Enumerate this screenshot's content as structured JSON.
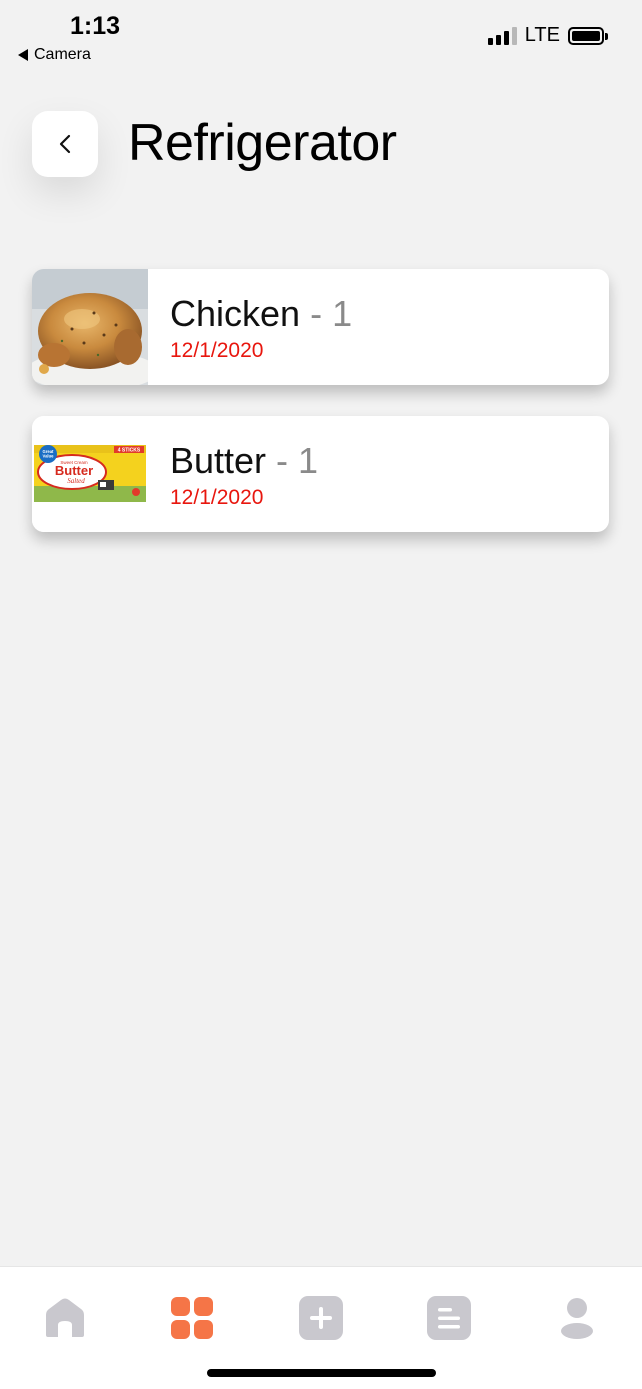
{
  "status_bar": {
    "time": "1:13",
    "back_app": "Camera",
    "network": "LTE"
  },
  "header": {
    "title": "Refrigerator",
    "back_icon": "chevron-left-icon"
  },
  "items": [
    {
      "name": "Chicken",
      "separator": " - ",
      "quantity": "1",
      "date": "12/1/2020",
      "image": "roast-chicken-photo"
    },
    {
      "name": "Butter",
      "separator": " - ",
      "quantity": "1",
      "date": "12/1/2020",
      "image": "butter-package-photo"
    }
  ],
  "butter_label": {
    "brand": "Great Value",
    "tag": "4 STICKS",
    "sub": "Sweet Cream",
    "name": "Butter",
    "variant": "Salted"
  },
  "tab_bar": {
    "tabs": [
      {
        "icon": "home-icon",
        "active": false
      },
      {
        "icon": "grid-icon",
        "active": true
      },
      {
        "icon": "plus-icon",
        "active": false
      },
      {
        "icon": "list-icon",
        "active": false
      },
      {
        "icon": "profile-icon",
        "active": false
      }
    ]
  },
  "colors": {
    "accent": "#f57547",
    "inactive_icon": "#c9c8ce",
    "date_red": "#e8160e",
    "background": "#f2f2f2"
  }
}
